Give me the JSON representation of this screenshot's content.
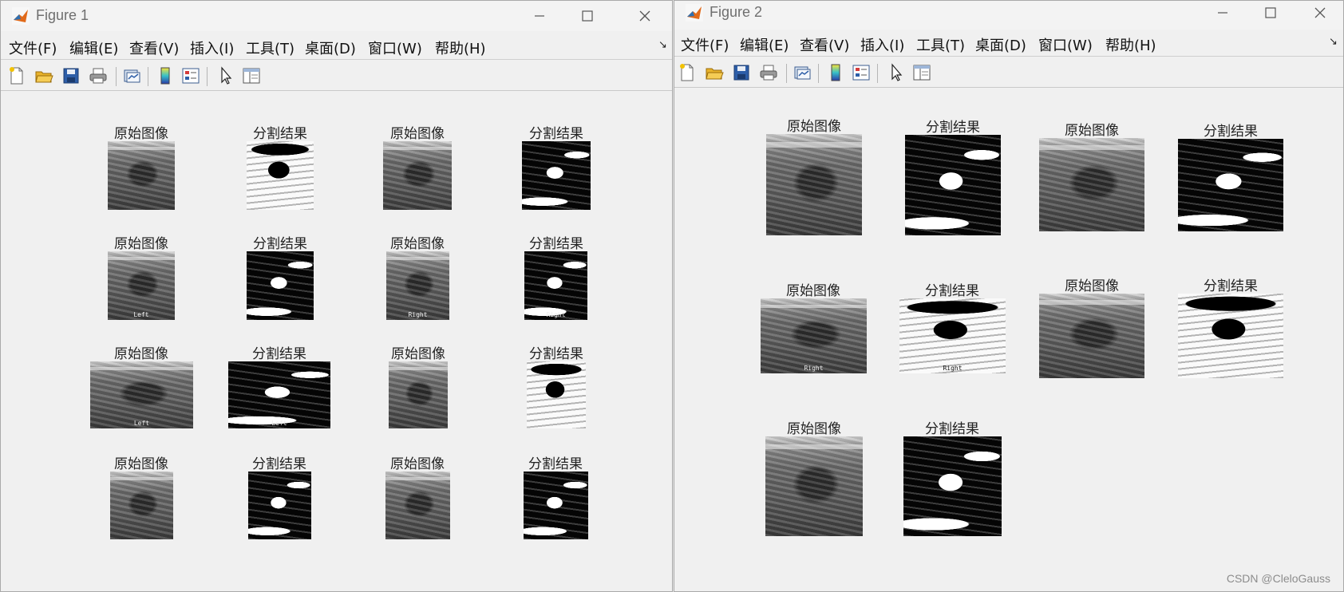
{
  "windows": [
    {
      "title": "Figure 1",
      "menu": [
        "文件(F)",
        "编辑(E)",
        "查看(V)",
        "插入(I)",
        "工具(T)",
        "桌面(D)",
        "窗口(W)",
        "帮助(H)"
      ],
      "panels": [
        {
          "title": "原始图像",
          "type": "orig",
          "label": ""
        },
        {
          "title": "分割结果",
          "type": "seg",
          "label": ""
        },
        {
          "title": "原始图像",
          "type": "orig",
          "label": ""
        },
        {
          "title": "分割结果",
          "type": "seg-light",
          "label": ""
        },
        {
          "title": "原始图像",
          "type": "orig",
          "label": "Left"
        },
        {
          "title": "分割结果",
          "type": "seg",
          "label": ""
        },
        {
          "title": "原始图像",
          "type": "orig",
          "label": "Right"
        },
        {
          "title": "分割结果",
          "type": "seg-light",
          "label": "Right"
        },
        {
          "title": "原始图像",
          "type": "orig",
          "label": "Left"
        },
        {
          "title": "分割结果",
          "type": "seg",
          "label": "Left"
        },
        {
          "title": "原始图像",
          "type": "orig",
          "label": ""
        },
        {
          "title": "分割结果",
          "type": "seg-light",
          "label": ""
        },
        {
          "title": "原始图像",
          "type": "orig",
          "label": ""
        },
        {
          "title": "分割结果",
          "type": "seg",
          "label": ""
        },
        {
          "title": "原始图像",
          "type": "orig",
          "label": ""
        },
        {
          "title": "分割结果",
          "type": "seg",
          "label": ""
        }
      ]
    },
    {
      "title": "Figure 2",
      "menu": [
        "文件(F)",
        "编辑(E)",
        "查看(V)",
        "插入(I)",
        "工具(T)",
        "桌面(D)",
        "窗口(W)",
        "帮助(H)"
      ],
      "panels": [
        {
          "title": "原始图像",
          "type": "orig",
          "label": ""
        },
        {
          "title": "分割结果",
          "type": "seg",
          "label": ""
        },
        {
          "title": "原始图像",
          "type": "orig",
          "label": ""
        },
        {
          "title": "分割结果",
          "type": "seg",
          "label": ""
        },
        {
          "title": "原始图像",
          "type": "orig",
          "label": "Right"
        },
        {
          "title": "分割结果",
          "type": "seg-light",
          "label": "Right"
        },
        {
          "title": "原始图像",
          "type": "orig",
          "label": ""
        },
        {
          "title": "分割结果",
          "type": "seg",
          "label": ""
        },
        {
          "title": "原始图像",
          "type": "orig",
          "label": ""
        },
        {
          "title": "分割结果",
          "type": "seg",
          "label": ""
        }
      ]
    }
  ],
  "toolbar_icons": [
    "new-figure-icon",
    "open-file-icon",
    "save-icon",
    "print-icon",
    "link-plot-icon",
    "insert-colorbar-icon",
    "insert-legend-icon",
    "edit-plot-icon",
    "property-inspector-icon"
  ],
  "watermark": "CSDN @CleloGauss",
  "colors": {
    "window_bg": "#f0f0f0",
    "border": "#a9a9a9"
  }
}
